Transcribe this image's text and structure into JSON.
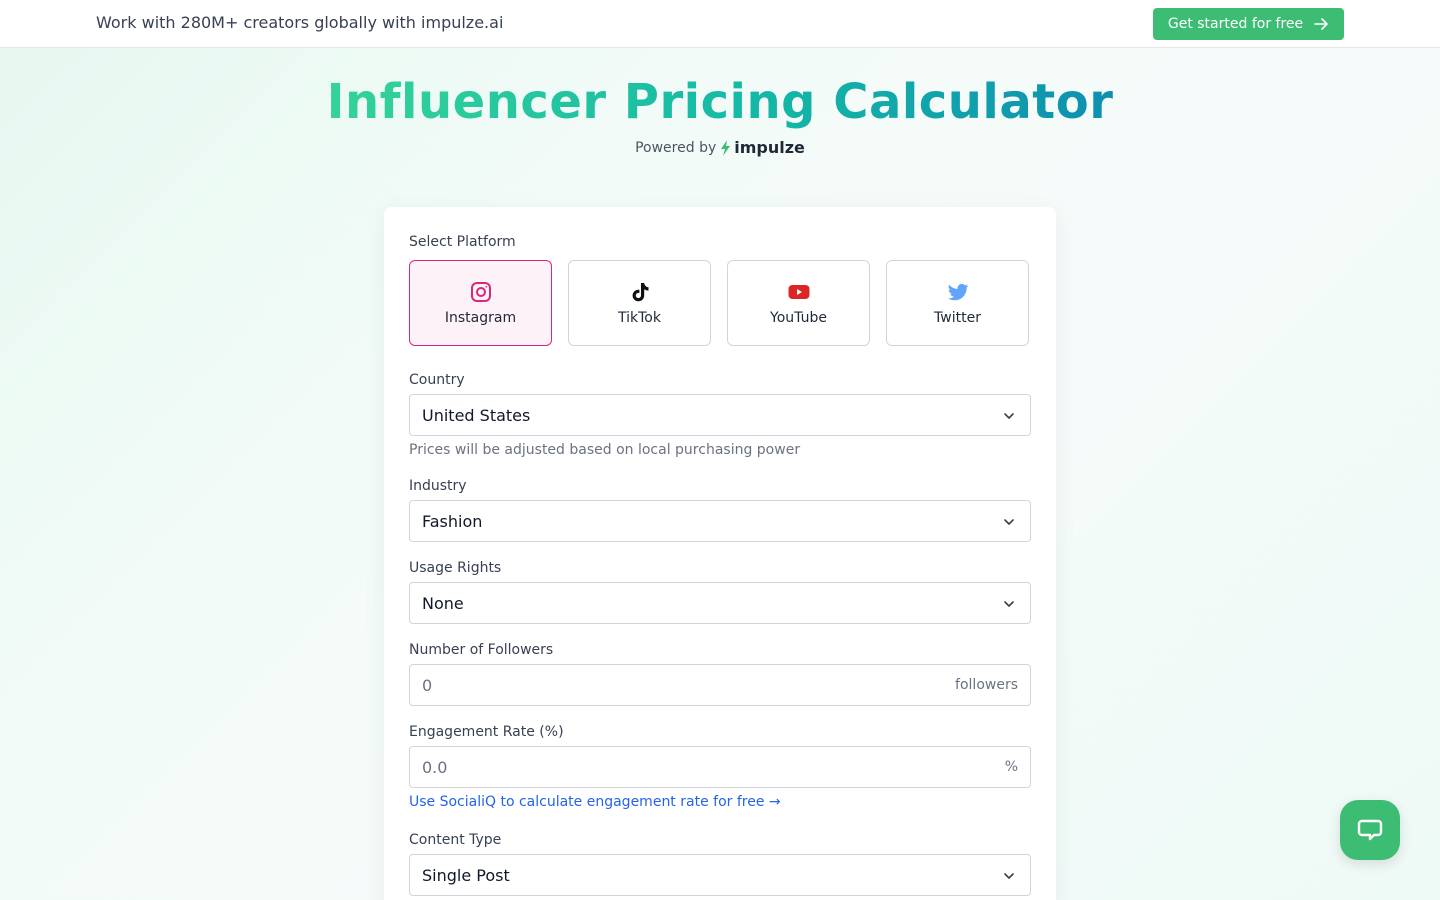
{
  "topbar": {
    "text": "Work with 280M+ creators globally with impulze.ai",
    "cta_label": "Get started for free"
  },
  "hero": {
    "title": "Influencer Pricing Calculator",
    "powered_by": "Powered by",
    "brand": "impulze"
  },
  "form": {
    "platform_label": "Select Platform",
    "platforms": [
      {
        "label": "Instagram",
        "icon": "instagram-icon",
        "selected": true
      },
      {
        "label": "TikTok",
        "icon": "tiktok-icon",
        "selected": false
      },
      {
        "label": "YouTube",
        "icon": "youtube-icon",
        "selected": false
      },
      {
        "label": "Twitter",
        "icon": "twitter-icon",
        "selected": false
      }
    ],
    "country_label": "Country",
    "country_value": "United States",
    "country_hint": "Prices will be adjusted based on local purchasing power",
    "industry_label": "Industry",
    "industry_value": "Fashion",
    "usage_label": "Usage Rights",
    "usage_value": "None",
    "followers_label": "Number of Followers",
    "followers_placeholder": "0",
    "followers_suffix": "followers",
    "engagement_label": "Engagement Rate (%)",
    "engagement_placeholder": "0.0",
    "engagement_suffix": "%",
    "engagement_link": "Use SocialiQ to calculate engagement rate for free →",
    "content_label": "Content Type",
    "content_value": "Single Post"
  },
  "colors": {
    "accent_green": "#3dbd73",
    "instagram_pink": "#db2777",
    "youtube_red": "#dc2626",
    "twitter_blue": "#60a5fa",
    "link_blue": "#2563eb"
  }
}
